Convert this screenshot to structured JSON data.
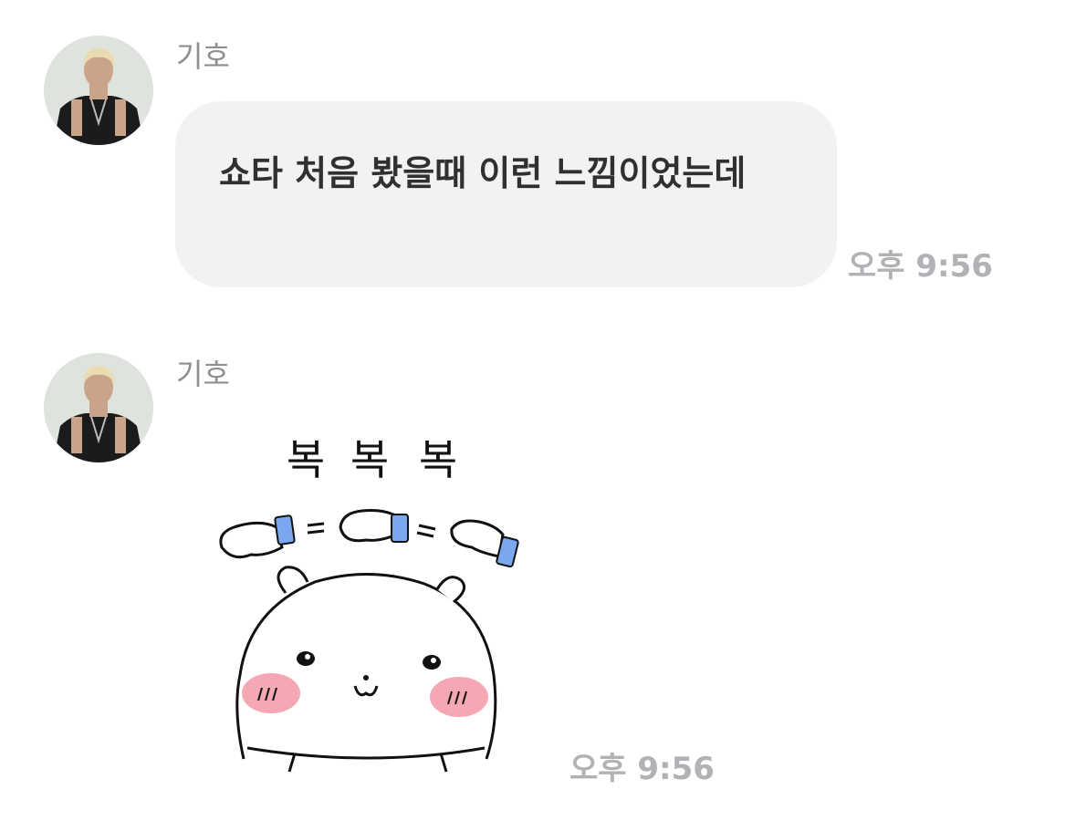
{
  "messages": [
    {
      "sender": "기호",
      "avatar_icon": "profile-photo-icon",
      "text": "쇼타 처음 봤을때 이런 느낌이었는데",
      "time": "오후 9:56"
    },
    {
      "sender": "기호",
      "avatar_icon": "profile-photo-icon",
      "sticker": {
        "icon": "bear-pat-sticker-icon",
        "caption": "복 복 복"
      },
      "time": "오후 9:56"
    }
  ],
  "colors": {
    "bubble_bg": "#f2f2f5",
    "sender": "#8e8e93",
    "time": "#b1b1b6",
    "text": "#303030",
    "blush": "#f28a9a",
    "cuff": "#7aa7ee"
  }
}
